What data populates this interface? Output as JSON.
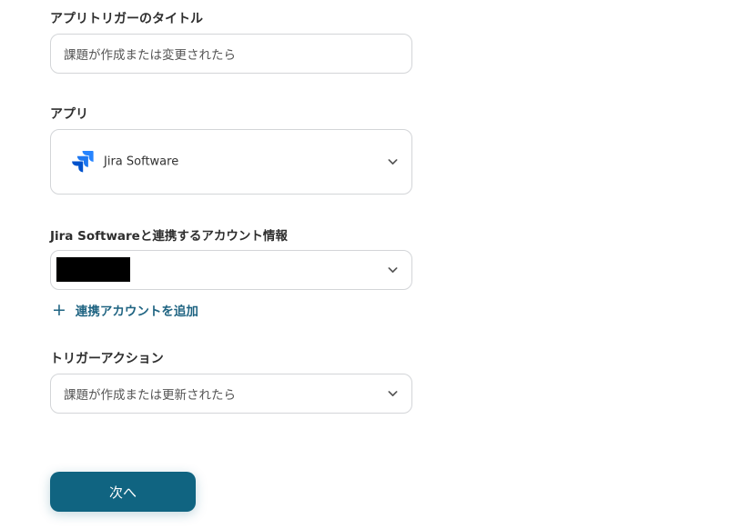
{
  "trigger_title": {
    "label": "アプリトリガーのタイトル",
    "value": "課題が作成または変更されたら"
  },
  "app": {
    "label": "アプリ",
    "selected": "Jira Software",
    "logo_icon": "jira-software-logo",
    "logo_color": "#2684ff"
  },
  "account": {
    "label": "Jira Softwareと連携するアカウント情報",
    "add_link": "連携アカウントを追加",
    "add_icon": "plus-icon",
    "link_color": "#1f6482"
  },
  "trigger_action": {
    "label": "トリガーアクション",
    "selected": "課題が作成または更新されたら"
  },
  "next_button": {
    "label": "次へ",
    "color": "#106481"
  }
}
